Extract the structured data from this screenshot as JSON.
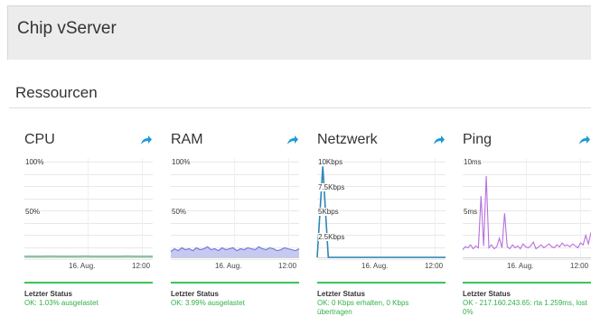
{
  "header": {
    "title": "Chip vServer"
  },
  "section": {
    "title": "Ressourcen"
  },
  "icons": {
    "open": "arrow-out-icon"
  },
  "colors": {
    "accent": "#1a9ad6",
    "ok": "#33b04a",
    "status_bar": "#3cc35a"
  },
  "cards": [
    {
      "title": "CPU",
      "y_labels": [
        "100%",
        "50%"
      ],
      "x_labels": [
        "16. Aug.",
        "12:00"
      ],
      "status_label": "Letzter Status",
      "status_text": "OK: 1.03% ausgelastet",
      "chart_data": {
        "type": "line",
        "ylim": [
          0,
          100
        ],
        "y_ticks": [
          "100%",
          "50%"
        ],
        "x_ticks": [
          "16. Aug.",
          "12:00"
        ],
        "series": [
          {
            "values": [
              1,
              1,
              1,
              1.1,
              1,
              1,
              1,
              1.1,
              1,
              1,
              1,
              1,
              1.1,
              1,
              1,
              1
            ]
          }
        ]
      }
    },
    {
      "title": "RAM",
      "y_labels": [
        "100%",
        "50%"
      ],
      "x_labels": [
        "16. Aug.",
        "12:00"
      ],
      "status_label": "Letzter Status",
      "status_text": "OK: 3.99% ausgelastet",
      "chart_data": {
        "type": "area",
        "ylim": [
          0,
          100
        ],
        "y_ticks": [
          "100%",
          "50%"
        ],
        "x_ticks": [
          "16. Aug.",
          "12:00"
        ],
        "series": [
          {
            "values": [
              6,
              9,
              7,
              10,
              8,
              9,
              7,
              10,
              8,
              9,
              11,
              8,
              9,
              7,
              10,
              8,
              9,
              10,
              7,
              9,
              8,
              10,
              9,
              8,
              11,
              9,
              8,
              10,
              9,
              7,
              8,
              10,
              9,
              8,
              7,
              9
            ]
          }
        ]
      }
    },
    {
      "title": "Netzwerk",
      "y_labels": [
        "10Kbps",
        "7.5Kbps",
        "5Kbps",
        "2.5Kbps"
      ],
      "x_labels": [
        "16. Aug.",
        "12:00"
      ],
      "status_label": "Letzter Status",
      "status_text": "OK: 0 Kbps erhalten, 0 Kbps übertragen",
      "chart_data": {
        "type": "line",
        "ylim": [
          0,
          10
        ],
        "y_ticks": [
          "10Kbps",
          "7.5Kbps",
          "5Kbps",
          "2.5Kbps"
        ],
        "x_ticks": [
          "16. Aug.",
          "12:00"
        ],
        "series": [
          {
            "values": [
              0,
              9.5,
              0,
              0,
              0,
              0,
              0,
              0,
              0,
              0,
              0,
              0,
              0,
              0,
              0,
              0,
              0,
              0,
              0,
              0,
              0,
              0,
              0,
              0
            ]
          }
        ]
      }
    },
    {
      "title": "Ping",
      "y_labels": [
        "10ms",
        "5ms"
      ],
      "x_labels": [
        "16. Aug.",
        "12:00"
      ],
      "status_label": "Letzter Status",
      "status_text": "OK - 217.160.243.65: rta 1.259ms, lost 0%",
      "chart_data": {
        "type": "line",
        "ylim": [
          0,
          10
        ],
        "y_ticks": [
          "10ms",
          "5ms"
        ],
        "x_ticks": [
          "16. Aug.",
          "12:00"
        ],
        "series": [
          {
            "values": [
              0.8,
              1.1,
              1.0,
              1.3,
              0.9,
              1.2,
              1.0,
              6.4,
              1.2,
              8.5,
              1.0,
              1.3,
              0.9,
              1.1,
              2.0,
              1.0,
              4.6,
              1.1,
              0.9,
              1.3,
              1.0,
              1.2,
              0.9,
              1.4,
              1.1,
              1.0,
              1.2,
              1.6,
              0.9,
              1.1,
              1.3,
              1.0,
              1.2,
              1.4,
              1.1,
              1.0,
              1.3,
              1.1,
              1.5,
              1.2,
              1.3,
              1.1,
              1.4,
              1.2,
              1.0,
              1.5,
              1.3,
              2.3,
              1.4,
              2.6
            ]
          }
        ]
      }
    }
  ]
}
